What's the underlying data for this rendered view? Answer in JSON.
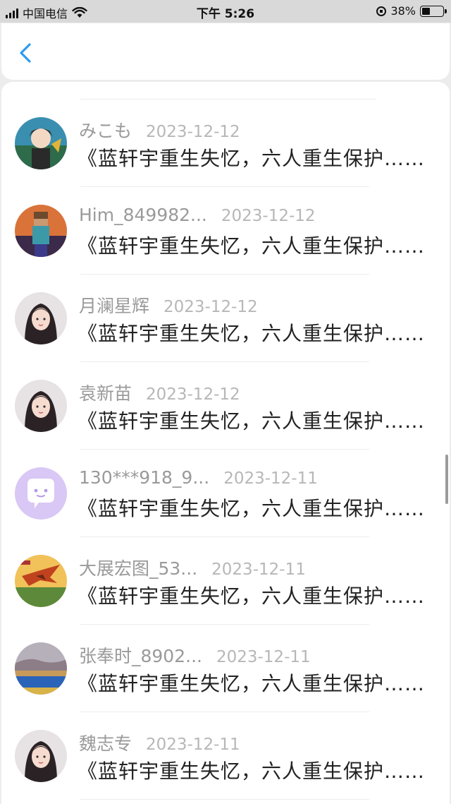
{
  "status_bar": {
    "carrier": "中国电信",
    "time": "下午 5:26",
    "battery": "38%",
    "battery_level": 0.38
  },
  "header": {
    "back_icon": "chevron-left-icon",
    "accent_color": "#2e9bf0"
  },
  "list": {
    "items": [
      {
        "name": "みこも",
        "date": "2023-12-12",
        "content": "《蓝轩宇重生失忆，六人重生保护……",
        "avatar": "anime-boy-avatar"
      },
      {
        "name": "Him_849982...",
        "date": "2023-12-12",
        "content": "《蓝轩宇重生失忆，六人重生保护……",
        "avatar": "minecraft-avatar"
      },
      {
        "name": "月澜星辉",
        "date": "2023-12-12",
        "content": "《蓝轩宇重生失忆，六人重生保护……",
        "avatar": "girl-photo-avatar"
      },
      {
        "name": "袁新苗",
        "date": "2023-12-12",
        "content": "《蓝轩宇重生失忆，六人重生保护……",
        "avatar": "girl-photo-avatar"
      },
      {
        "name": "130***918_9...",
        "date": "2023-12-11",
        "content": "《蓝轩宇重生失忆，六人重生保护……",
        "avatar": "default-chat-avatar"
      },
      {
        "name": "大展宏图_53...",
        "date": "2023-12-11",
        "content": "《蓝轩宇重生失忆，六人重生保护……",
        "avatar": "eagle-landscape-avatar"
      },
      {
        "name": "张奉时_8902...",
        "date": "2023-12-11",
        "content": "《蓝轩宇重生失忆，六人重生保护……",
        "avatar": "lake-landscape-avatar"
      },
      {
        "name": "魏志专",
        "date": "2023-12-11",
        "content": "《蓝轩宇重生失忆，六人重生保护……",
        "avatar": "girl-photo-avatar"
      }
    ]
  }
}
